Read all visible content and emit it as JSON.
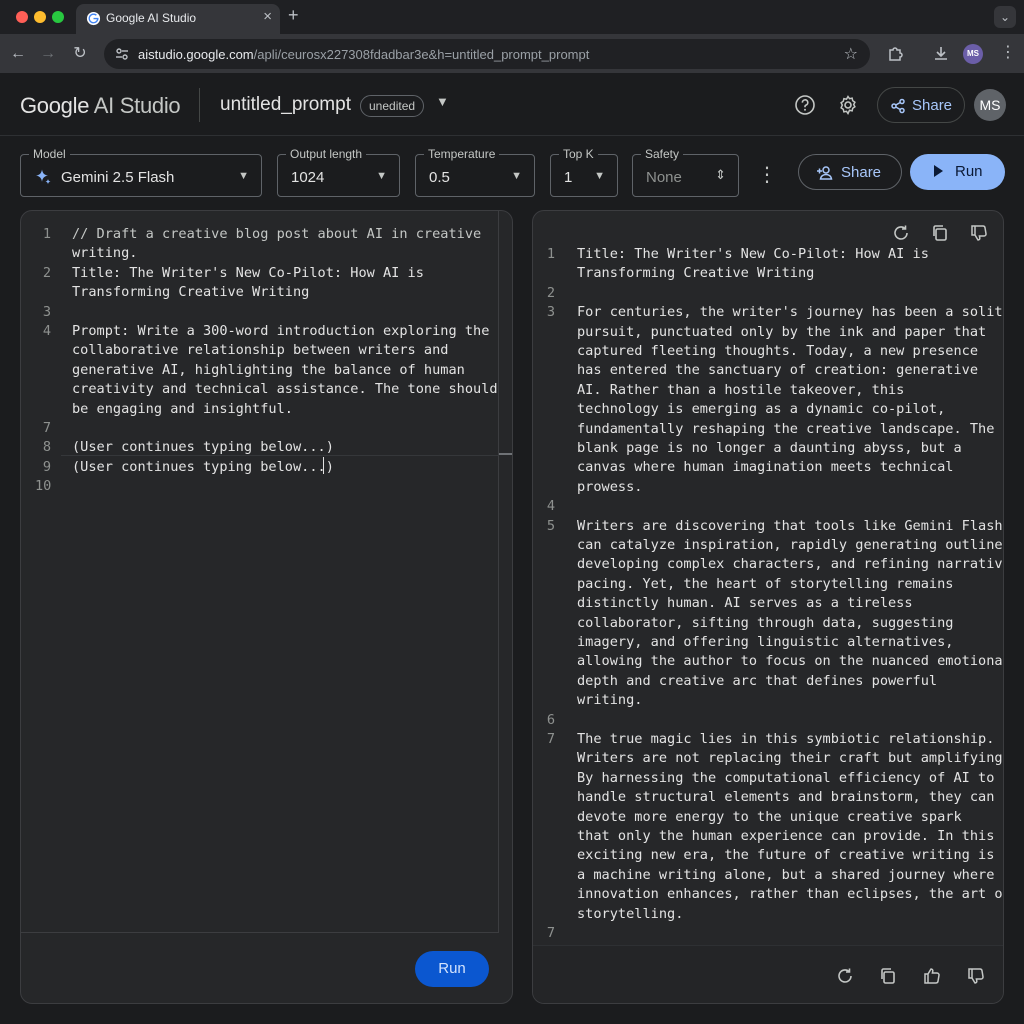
{
  "browser": {
    "tab_title": "Google AI Studio",
    "url_host": "aistudio.google.com",
    "url_path": "/apli/ceurosx227308fdadbar3e&h=untitled_prompt_prompt",
    "profile_initials": "MS"
  },
  "header": {
    "logo_google": "Google",
    "logo_product": "AI Studio",
    "prompt_title": "untitled_prompt",
    "status_badge": "unedited",
    "share_label": "Share",
    "avatar_initials": "MS"
  },
  "settings": {
    "model": {
      "label": "Model",
      "value": "Gemini 2.5 Flash"
    },
    "output_length": {
      "label": "Output length",
      "value": "1024"
    },
    "temperature": {
      "label": "Temperature",
      "value": "0.5"
    },
    "top_k": {
      "label": "Top K",
      "value": "1"
    },
    "safety": {
      "label": "Safety",
      "value": "None"
    },
    "share_label": "Share",
    "run_label": "Run"
  },
  "editor": {
    "lines": [
      {
        "n": "1",
        "text": "// Draft a creative blog post about AI in creative"
      },
      {
        "n": "",
        "text": "writing."
      },
      {
        "n": "2",
        "text": "Title: The Writer's New Co-Pilot: How AI is"
      },
      {
        "n": "",
        "text": "Transforming Creative Writing"
      },
      {
        "n": "3",
        "text": ""
      },
      {
        "n": "4",
        "text": "Prompt: Write a 300-word introduction exploring the"
      },
      {
        "n": "",
        "text": "collaborative relationship between writers and"
      },
      {
        "n": "",
        "text": "generative AI, highlighting the balance of human"
      },
      {
        "n": "",
        "text": "creativity and technical assistance. The tone should"
      },
      {
        "n": "",
        "text": "be engaging and insightful."
      },
      {
        "n": "7",
        "text": ""
      },
      {
        "n": "8",
        "text": "(User continues typing below...)"
      },
      {
        "n": "9",
        "text": "(User continues typing below...)"
      },
      {
        "n": "10",
        "text": ""
      }
    ],
    "run_label": "Run"
  },
  "response": {
    "lines": [
      {
        "n": "1",
        "text": "Title: The Writer's New Co-Pilot: How AI is"
      },
      {
        "n": "",
        "text": "Transforming Creative Writing"
      },
      {
        "n": "2",
        "text": ""
      },
      {
        "n": "3",
        "text": "For centuries, the writer's journey has been a solitary"
      },
      {
        "n": "",
        "text": "pursuit, punctuated only by the ink and paper that"
      },
      {
        "n": "",
        "text": "captured fleeting thoughts. Today, a new presence"
      },
      {
        "n": "",
        "text": "has entered the sanctuary of creation: generative"
      },
      {
        "n": "",
        "text": "AI. Rather than a hostile takeover, this"
      },
      {
        "n": "",
        "text": "technology is emerging as a dynamic co-pilot,"
      },
      {
        "n": "",
        "text": "fundamentally reshaping the creative landscape. The"
      },
      {
        "n": "",
        "text": "blank page is no longer a daunting abyss, but a"
      },
      {
        "n": "",
        "text": "canvas where human imagination meets technical"
      },
      {
        "n": "",
        "text": "prowess."
      },
      {
        "n": "4",
        "text": ""
      },
      {
        "n": "5",
        "text": "Writers are discovering that tools like Gemini Flash"
      },
      {
        "n": "",
        "text": "can catalyze inspiration, rapidly generating outlines,"
      },
      {
        "n": "",
        "text": "developing complex characters, and refining narrative"
      },
      {
        "n": "",
        "text": "pacing. Yet, the heart of storytelling remains"
      },
      {
        "n": "",
        "text": "distinctly human. AI serves as a tireless"
      },
      {
        "n": "",
        "text": "collaborator, sifting through data, suggesting"
      },
      {
        "n": "",
        "text": "imagery, and offering linguistic alternatives,"
      },
      {
        "n": "",
        "text": "allowing the author to focus on the nuanced emotional"
      },
      {
        "n": "",
        "text": "depth and creative arc that defines powerful"
      },
      {
        "n": "",
        "text": "writing."
      },
      {
        "n": "6",
        "text": ""
      },
      {
        "n": "7",
        "text": "The true magic lies in this symbiotic relationship."
      },
      {
        "n": "",
        "text": "Writers are not replacing their craft but amplifying it."
      },
      {
        "n": "",
        "text": "By harnessing the computational efficiency of AI to"
      },
      {
        "n": "",
        "text": "handle structural elements and brainstorm, they can"
      },
      {
        "n": "",
        "text": "devote more energy to the unique creative spark"
      },
      {
        "n": "",
        "text": "that only the human experience can provide. In this"
      },
      {
        "n": "",
        "text": "exciting new era, the future of creative writing is not"
      },
      {
        "n": "",
        "text": "a machine writing alone, but a shared journey where"
      },
      {
        "n": "",
        "text": "innovation enhances, rather than eclipses, the art of"
      },
      {
        "n": "",
        "text": "storytelling."
      },
      {
        "n": "7",
        "text": ""
      }
    ]
  },
  "icons": {
    "regenerate": "refresh-icon",
    "copy": "copy-icon",
    "thumbs_up": "thumbs-up-icon",
    "thumbs_down": "thumbs-down-icon",
    "help": "help-icon",
    "settings": "gear-icon",
    "share": "share-icon",
    "sparkle": "sparkle-icon"
  },
  "colors": {
    "background": "#1b1c1e",
    "panel": "#262729",
    "accent": "#8ab4f8",
    "run_button": "#0b57d0",
    "share_text": "#a8c7fa"
  }
}
